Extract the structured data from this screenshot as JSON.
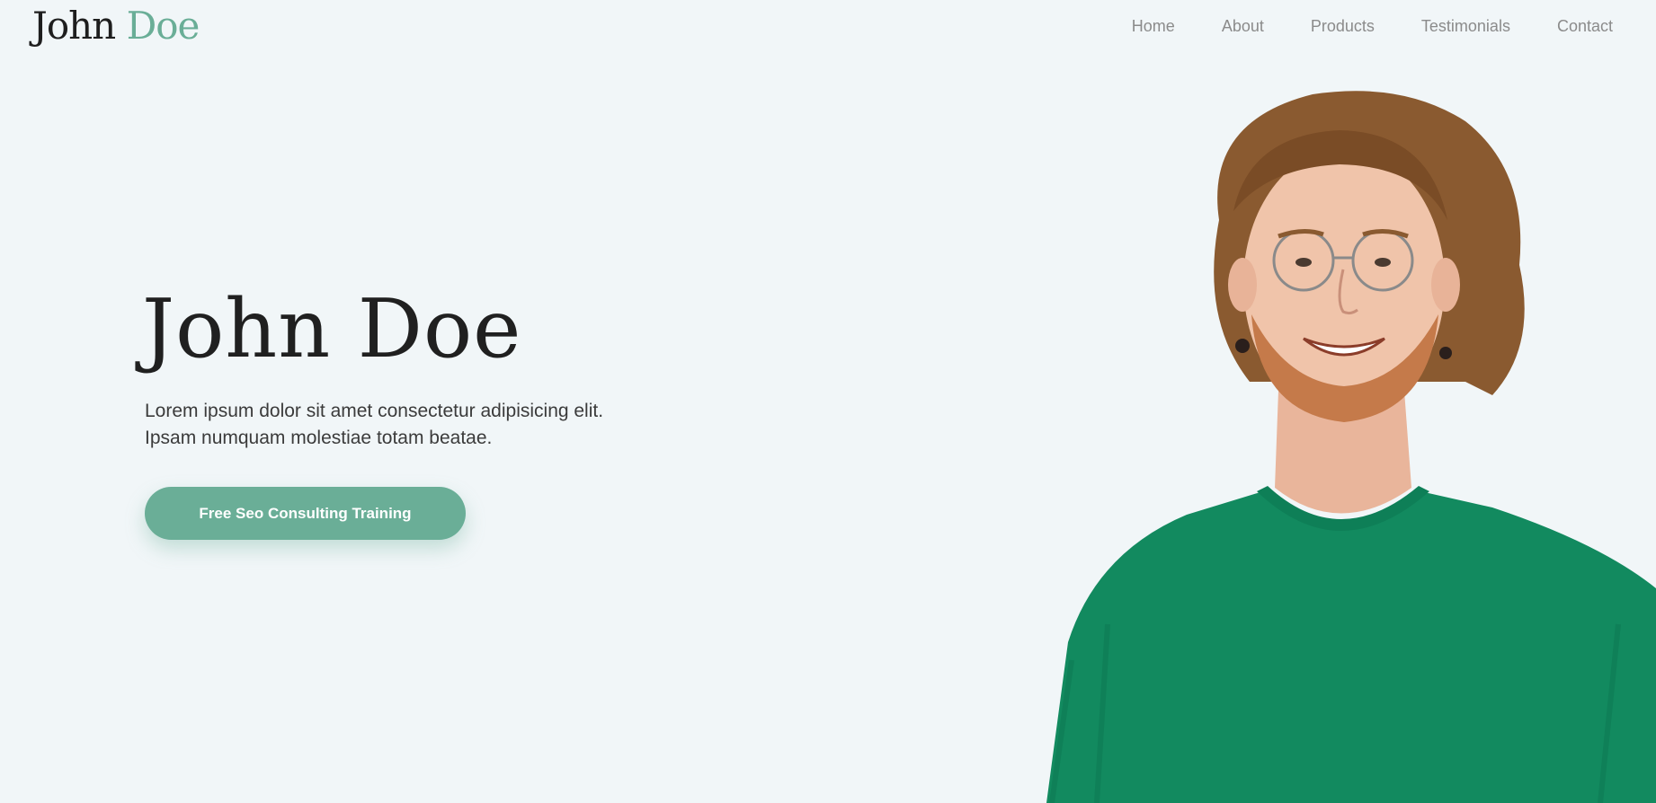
{
  "brand": {
    "first": "John",
    "last": "Doe",
    "accent_color": "#6aae97"
  },
  "nav": {
    "items": [
      "Home",
      "About",
      "Products",
      "Testimonials",
      "Contact"
    ]
  },
  "hero": {
    "title": "John Doe",
    "description": "Lorem ipsum dolor sit amet consectetur adipisicing elit. Ipsam numquam molestiae totam beatae.",
    "cta_label": "Free Seo Consulting Training"
  },
  "colors": {
    "background": "#f1f6f8",
    "sweater": "#128a5f",
    "text_dark": "#202020",
    "nav_text": "#8b8b8b"
  }
}
